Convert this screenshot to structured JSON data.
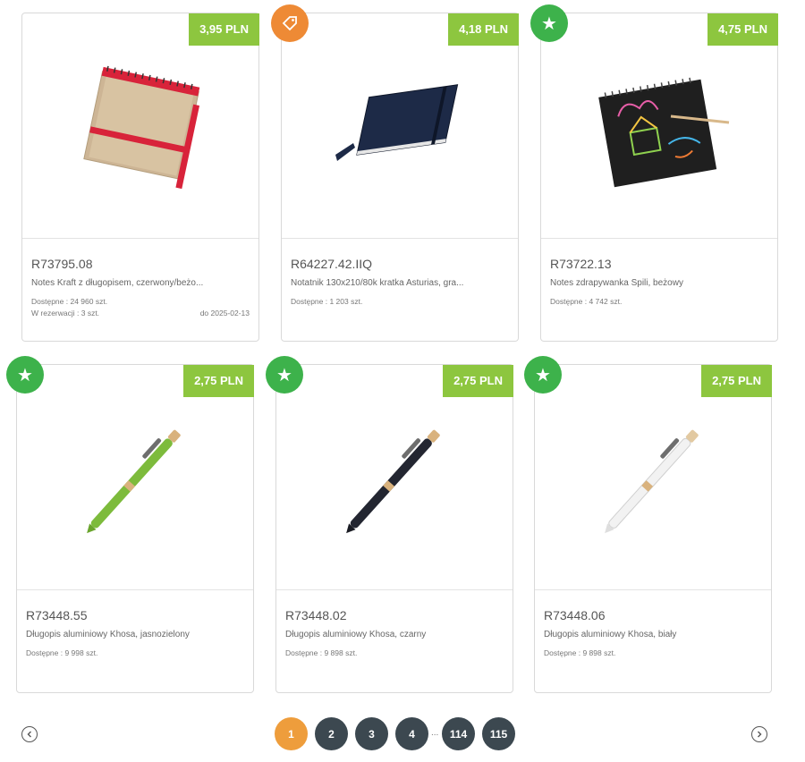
{
  "products": [
    {
      "code": "R73795.08",
      "name": "Notes Kraft z długopisem, czerwony/beżo...",
      "price": "3,95 PLN",
      "stock": "Dostępne : 24 960 szt.",
      "reservation": "W rezerwacji : 3 szt.",
      "reservation_date": "do 2025-02-13",
      "badge": "none"
    },
    {
      "code": "R64227.42.IIQ",
      "name": "Notatnik 130x210/80k kratka Asturias, gra...",
      "price": "4,18 PLN",
      "stock": "Dostępne : 1 203 szt.",
      "badge": "tag-icon"
    },
    {
      "code": "R73722.13",
      "name": "Notes zdrapywanka Spili, beżowy",
      "price": "4,75 PLN",
      "stock": "Dostępne : 4 742 szt.",
      "badge": "star-icon"
    },
    {
      "code": "R73448.55",
      "name": "Długopis aluminiowy Khosa, jasnozielony",
      "price": "2,75 PLN",
      "stock": "Dostępne : 9 998 szt.",
      "badge": "star-icon"
    },
    {
      "code": "R73448.02",
      "name": "Długopis aluminiowy Khosa, czarny",
      "price": "2,75 PLN",
      "stock": "Dostępne : 9 898 szt.",
      "badge": "star-icon"
    },
    {
      "code": "R73448.06",
      "name": "Długopis aluminiowy Khosa, biały",
      "price": "2,75 PLN",
      "stock": "Dostępne : 9 898 szt.",
      "badge": "star-icon"
    }
  ],
  "pagination": {
    "pages": [
      "1",
      "2",
      "3",
      "4",
      "114",
      "115"
    ],
    "current": "1",
    "ellipsis": "...",
    "prev_icon": "chevron-left-icon",
    "next_icon": "chevron-right-icon"
  },
  "colors": {
    "price_bg": "#8dc63f",
    "star_badge": "#3db24b",
    "tag_badge": "#ee8a35",
    "active_page": "#ee9d3c",
    "page": "#3c4850"
  }
}
